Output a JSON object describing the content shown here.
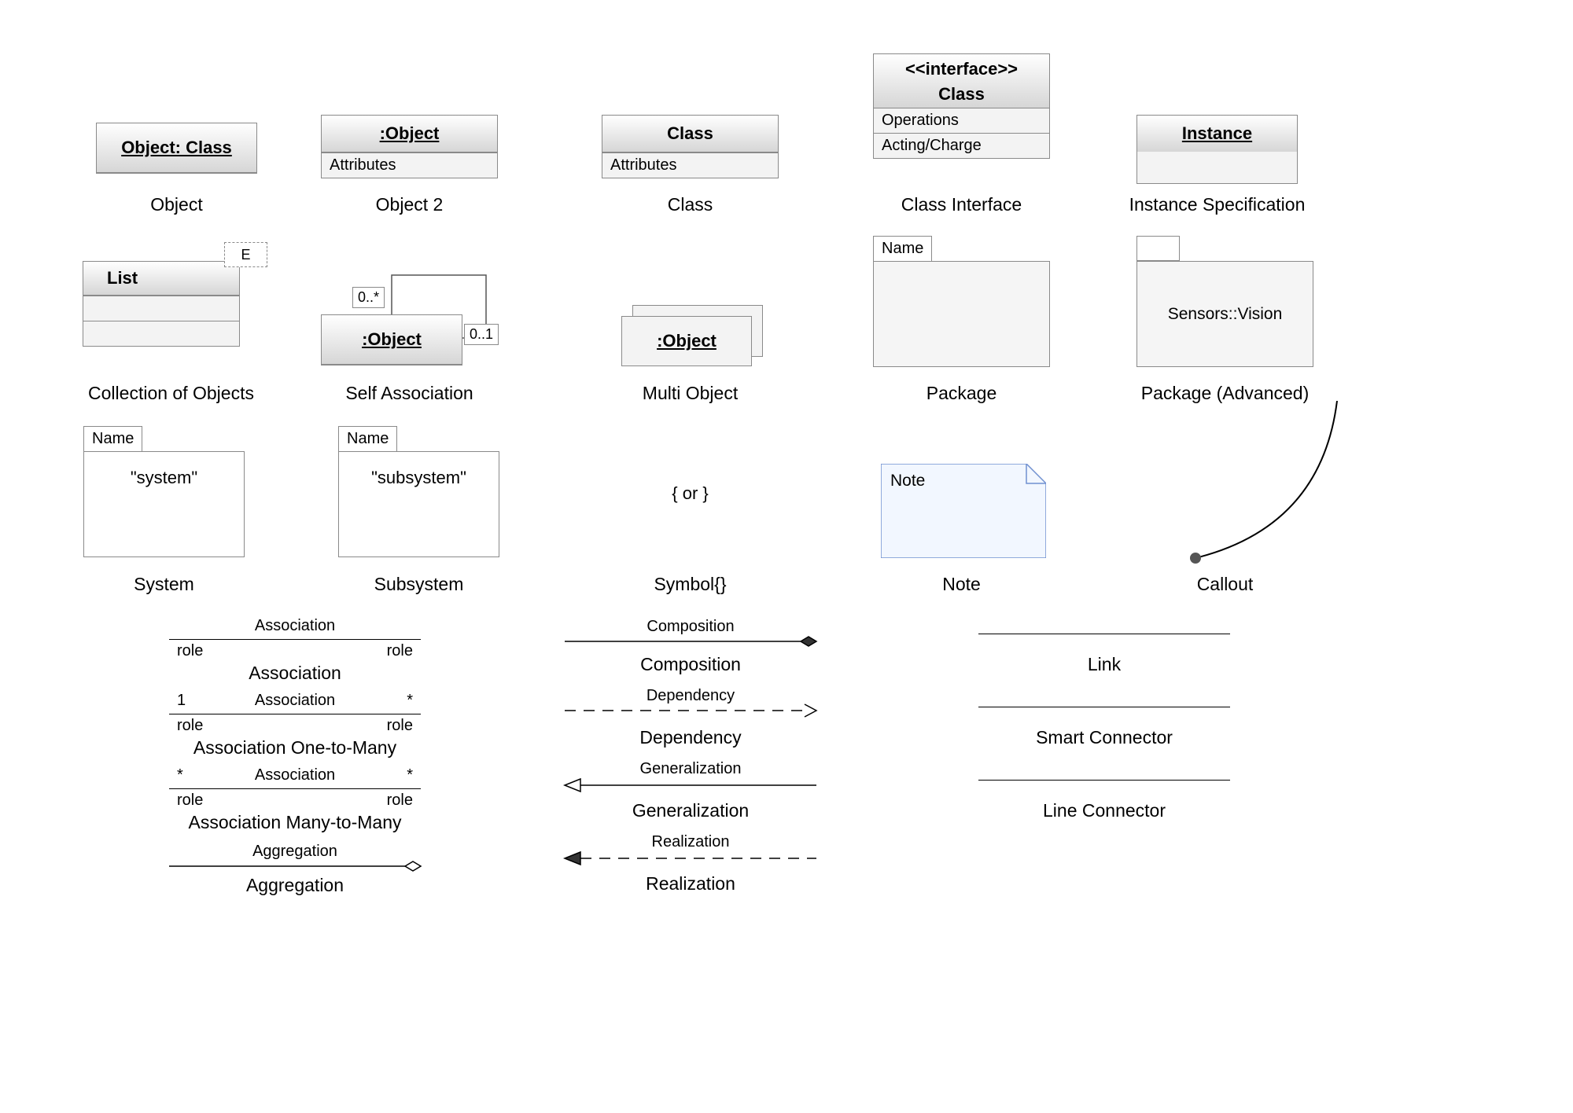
{
  "row1": {
    "object": {
      "header": "Object: Class",
      "caption": "Object"
    },
    "object2": {
      "header": ":Object",
      "attrs": "Attributes",
      "caption": "Object 2"
    },
    "class": {
      "header": "Class",
      "attrs": "Attributes",
      "caption": "Class"
    },
    "classIf": {
      "stereo": "<<interface>>",
      "name": "Class",
      "op": "Operations",
      "act": "Acting/Charge",
      "caption": "Class Interface"
    },
    "instance": {
      "header": "Instance",
      "caption": "Instance Specification"
    }
  },
  "row2": {
    "collection": {
      "badge": "E",
      "header": "List",
      "caption": "Collection of Objects"
    },
    "selfassoc": {
      "m1": "0..*",
      "m2": "0..1",
      "header": ":Object",
      "caption": "Self Association"
    },
    "multi": {
      "header": ":Object",
      "caption": "Multi Object"
    },
    "package": {
      "tab": "Name",
      "caption": "Package"
    },
    "pkgAdv": {
      "body": "Sensors::Vision",
      "caption": "Package (Advanced)"
    }
  },
  "row3": {
    "system": {
      "tab": "Name",
      "body": "\"system\"",
      "caption": "System"
    },
    "subsystem": {
      "tab": "Name",
      "body": "\"subsystem\"",
      "caption": "Subsystem"
    },
    "symbol": {
      "body": "{ or }",
      "caption": "Symbol{}"
    },
    "note": {
      "body": "Note",
      "caption": "Note"
    },
    "callout": {
      "caption": "Callout"
    }
  },
  "connectors": {
    "assoc": {
      "top": "Association",
      "roleL": "role",
      "roleR": "role",
      "caption": "Association"
    },
    "assoc1m": {
      "l": "1",
      "mid": "Association",
      "r": "*",
      "roleL": "role",
      "roleR": "role",
      "caption": "Association One-to-Many"
    },
    "assocmm": {
      "l": "*",
      "mid": "Association",
      "r": "*",
      "roleL": "role",
      "roleR": "role",
      "caption": "Association Many-to-Many"
    },
    "aggreg": {
      "top": "Aggregation",
      "caption": "Aggregation"
    },
    "comp": {
      "top": "Composition",
      "caption": "Composition"
    },
    "dep": {
      "top": "Dependency",
      "caption": "Dependency"
    },
    "gen": {
      "top": "Generalization",
      "caption": "Generalization"
    },
    "real": {
      "top": "Realization",
      "caption": "Realization"
    },
    "link": {
      "caption": "Link"
    },
    "smart": {
      "caption": "Smart Connector"
    },
    "line": {
      "caption": "Line Connector"
    }
  }
}
